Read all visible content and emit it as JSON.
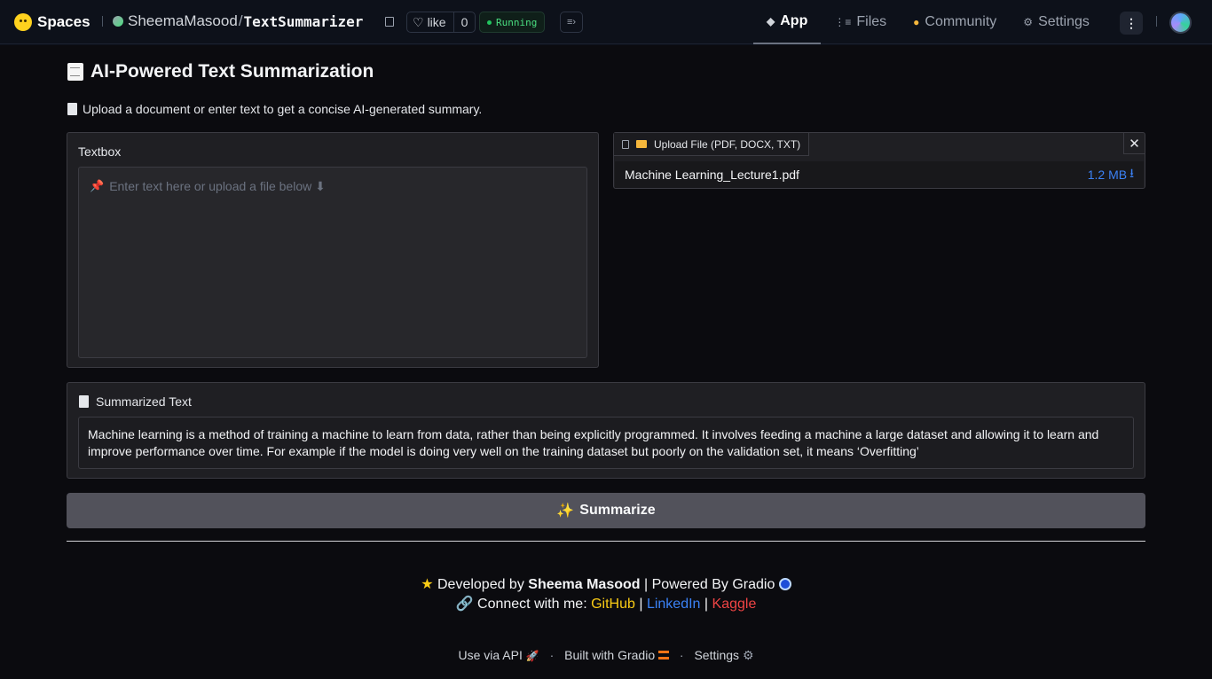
{
  "topbar": {
    "brand": "Spaces",
    "owner": "SheemaMasood",
    "separator": "/",
    "repo": "TextSummarizer",
    "like_label": "like",
    "like_count": "0",
    "status": "Running",
    "nav": [
      {
        "label": "App",
        "icon": "cube-icon",
        "active": true
      },
      {
        "label": "Files",
        "icon": "files-icon",
        "active": false
      },
      {
        "label": "Community",
        "icon": "community-icon",
        "active": false
      },
      {
        "label": "Settings",
        "icon": "gear-icon",
        "active": false
      }
    ]
  },
  "app": {
    "title": "AI-Powered Text Summarization",
    "subtitle": "Upload a document or enter text to get a concise AI-generated summary.",
    "textbox": {
      "label": "Textbox",
      "placeholder": "Enter text here or upload a file below ⬇"
    },
    "upload": {
      "label": "Upload File (PDF, DOCX, TXT)",
      "file_name": "Machine Learning_Lecture1.pdf",
      "file_size": "1.2 MB",
      "download_glyph": "⭳"
    },
    "summary": {
      "label": "Summarized Text",
      "text": "Machine learning is a method of training a machine to learn from data, rather than being explicitly programmed. It involves feeding a machine a large dataset and allowing it to learn and improve performance over time. For example if the model is doing very well on the training dataset but poorly on the validation set, it means ‘Overfitting’"
    },
    "button_label": "Summarize"
  },
  "footer": {
    "dev_prefix": "Developed by",
    "dev_name": "Sheema Masood",
    "powered": "| Powered By Gradio",
    "connect": "Connect with me:",
    "github": "GitHub",
    "linkedin": "LinkedIn",
    "kaggle": "Kaggle",
    "pipe": "|",
    "use_api": "Use via API",
    "built_with": "Built with Gradio",
    "settings": "Settings",
    "dot": "·"
  }
}
